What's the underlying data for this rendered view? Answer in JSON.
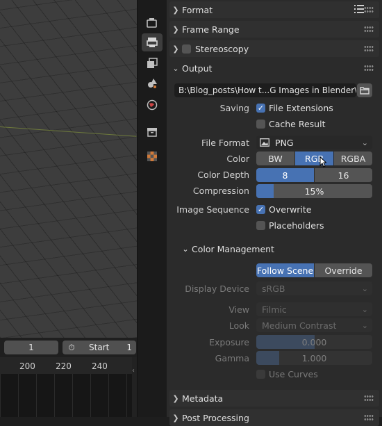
{
  "timeline": {
    "current_frame": "1",
    "start_label": "Start",
    "start_value": "1",
    "ruler": [
      "200",
      "220",
      "240"
    ]
  },
  "tabs": [
    "render-icon",
    "output-icon",
    "view-layer-icon",
    "scene-icon",
    "world-icon",
    "collection-icon",
    "texture-icon"
  ],
  "panels": {
    "format": "Format",
    "frame_range": "Frame Range",
    "stereoscopy": "Stereoscopy",
    "output": "Output",
    "metadata": "Metadata",
    "post_processing": "Post Processing"
  },
  "output": {
    "path": "B:\\Blog_posts\\How t...G Images in Blender\\",
    "saving_label": "Saving",
    "file_extensions": "File Extensions",
    "cache_result": "Cache Result",
    "file_format_label": "File Format",
    "file_format_value": "PNG",
    "color_label": "Color",
    "color_options": [
      "BW",
      "RGB",
      "RGBA"
    ],
    "color_selected": "RGB",
    "color_depth_label": "Color Depth",
    "color_depth_options": [
      "8",
      "16"
    ],
    "color_depth_selected": "8",
    "compression_label": "Compression",
    "compression_value": "15%",
    "compression_fraction": 0.15,
    "image_sequence_label": "Image Sequence",
    "overwrite": "Overwrite",
    "placeholders": "Placeholders"
  },
  "color_management": {
    "title": "Color Management",
    "follow_scene": "Follow Scene",
    "override": "Override",
    "display_device_label": "Display Device",
    "display_device_value": "sRGB",
    "view_label": "View",
    "view_value": "Filmic",
    "look_label": "Look",
    "look_value": "Medium Contrast",
    "exposure_label": "Exposure",
    "exposure_value": "0.000",
    "gamma_label": "Gamma",
    "gamma_value": "1.000",
    "gamma_fraction": 0.2,
    "use_curves": "Use Curves"
  },
  "colors": {
    "accent": "#4772b3",
    "panel": "#2b2b2b",
    "widget": "#545454"
  }
}
